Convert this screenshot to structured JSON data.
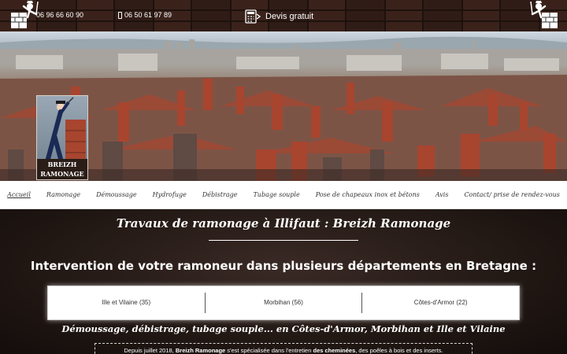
{
  "topbar": {
    "phone_fixed": "06 96 66 60 90",
    "phone_mobile": "06 50 61 97 89",
    "quote_label": "Devis gratuit"
  },
  "hero": {
    "logo_line1": "BREIZH",
    "logo_line2": "RAMONAGE"
  },
  "nav": {
    "items": [
      "Accueil",
      "Ramonage",
      "Démoussage",
      "Hydrofuge",
      "Débistrage",
      "Tubage souple",
      "Pose de chapeaux inox et bétons",
      "Avis",
      "Contact/ prise de rendez-vous"
    ],
    "active": "Accueil"
  },
  "main": {
    "title": "Travaux de ramonage à Illifaut : Breizh Ramonage",
    "subtitle": "Intervention de votre ramoneur dans plusieurs départements en Bretagne :",
    "departments": [
      "Ille et Vilaine (35)",
      "Morbihan (56)",
      "Côtes-d'Armor (22)"
    ],
    "services_heading": "Démoussage, débistrage, tubage souple... en Côtes-d'Armor, Morbihan et Ille et Vilaine",
    "intro_prefix": "Depuis juillet 2018, ",
    "intro_brand": "Breizh Ramonage",
    "intro_middle": " s'est spécialisée dans l'entretien ",
    "intro_strong": "des cheminées",
    "intro_suffix": ", des poêles à bois et des inserts."
  },
  "colors": {
    "brick": "#3a241c",
    "dark_bg": "#231915",
    "nav_bg": "#ffffff"
  }
}
